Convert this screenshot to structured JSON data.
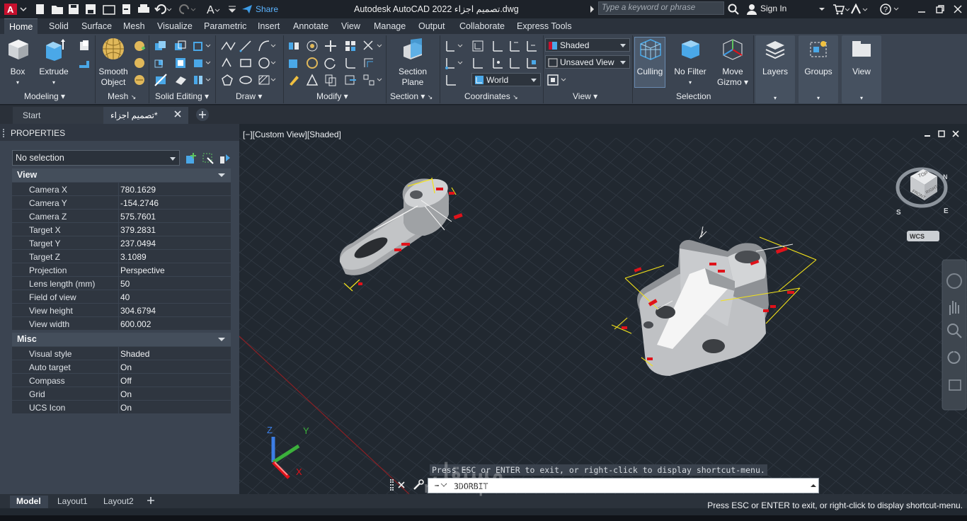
{
  "colors": {
    "app_bg": "#212830",
    "ribbon_bg": "#3b4451",
    "accent_blue": "#3c9be6",
    "model_gray": "#a9abae",
    "dimension_yellow": "#f2e11a",
    "dimension_red": "#e0121a"
  },
  "titlebar": {
    "title": "Autodesk AutoCAD 2022  تصميم اجزاء.dwg",
    "share_label": "Share",
    "search_placeholder": "Type a keyword or phrase",
    "sign_in": "Sign In"
  },
  "ribbon_tabs": [
    "Home",
    "Solid",
    "Surface",
    "Mesh",
    "Visualize",
    "Parametric",
    "Insert",
    "Annotate",
    "View",
    "Manage",
    "Output",
    "Collaborate",
    "Express Tools"
  ],
  "ribbon": {
    "box": "Box",
    "extrude": "Extrude",
    "smooth_object_1": "Smooth",
    "smooth_object_2": "Object",
    "section_plane_1": "Section",
    "section_plane_2": "Plane",
    "culling": "Culling",
    "no_filter": "No Filter",
    "move_gizmo_1": "Move",
    "move_gizmo_2": "Gizmo",
    "layers": "Layers",
    "groups": "Groups",
    "view": "View",
    "visual_style": "Shaded",
    "named_view": "Unsaved View",
    "ucs": "World",
    "panels": [
      "Modeling",
      "Mesh",
      "Solid Editing",
      "Draw",
      "Modify",
      "Section",
      "Coordinates",
      "View",
      "Selection"
    ]
  },
  "file_tabs": {
    "start": "Start",
    "document": "تصميم اجزاء*"
  },
  "properties": {
    "title": "PROPERTIES",
    "selection": "No selection",
    "view_section": "View",
    "view_rows": [
      {
        "k": "Camera X",
        "v": "780.1629"
      },
      {
        "k": "Camera Y",
        "v": "-154.2746"
      },
      {
        "k": "Camera Z",
        "v": "575.7601"
      },
      {
        "k": "Target X",
        "v": "379.2831"
      },
      {
        "k": "Target Y",
        "v": "237.0494"
      },
      {
        "k": "Target Z",
        "v": "3.1089"
      },
      {
        "k": "Projection",
        "v": "Perspective"
      },
      {
        "k": "Lens length (mm)",
        "v": "50"
      },
      {
        "k": "Field of view",
        "v": "40"
      },
      {
        "k": "View height",
        "v": "304.6794"
      },
      {
        "k": "View width",
        "v": "600.002"
      }
    ],
    "misc_section": "Misc",
    "misc_rows": [
      {
        "k": "Visual style",
        "v": "Shaded"
      },
      {
        "k": "Auto target",
        "v": "On"
      },
      {
        "k": "Compass",
        "v": "Off"
      },
      {
        "k": "Grid",
        "v": "On"
      },
      {
        "k": "UCS Icon",
        "v": "On"
      }
    ]
  },
  "viewport": {
    "label": "[−][Custom View][Shaded]",
    "viewcube_top": "TOP",
    "viewcube_front": "FRONT",
    "viewcube_right": "RIGHT",
    "compass_n": "N",
    "compass_s": "S",
    "compass_e": "E",
    "wcs": "WCS",
    "ucs_x": "X",
    "ucs_y": "Y",
    "ucs_z": "Z"
  },
  "command": {
    "history": "Press ESC or ENTER to exit, or right-click to display shortcut-menu.",
    "input": "3DORBIT"
  },
  "layout_tabs": [
    "Model",
    "Layout1",
    "Layout2"
  ],
  "status_message": "Press ESC or ENTER to exit, or right-click to display shortcut-menu.",
  "watermark": "mostaql.com",
  "watermark_ar": "مستقل"
}
